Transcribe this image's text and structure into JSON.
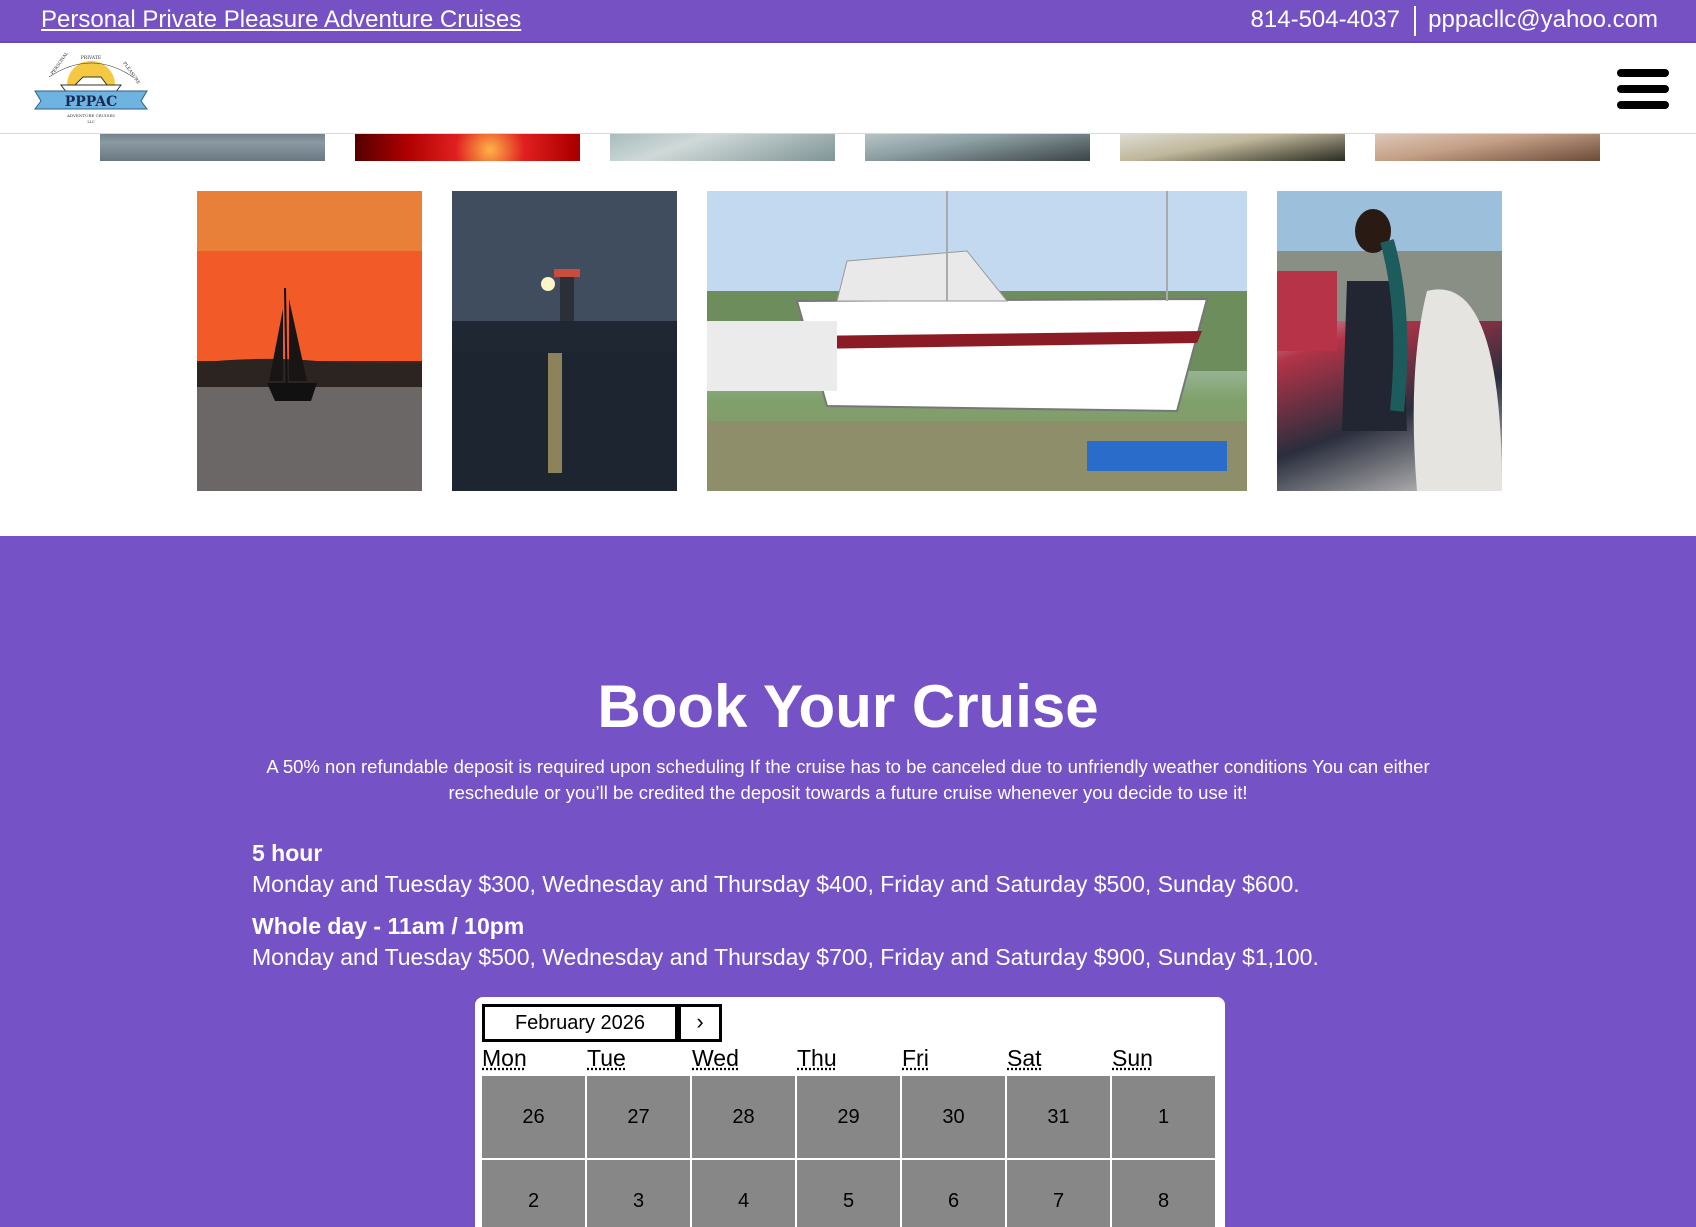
{
  "topbar": {
    "site_title": "Personal Private Pleasure Adventure Cruises",
    "phone": "814-504-4037",
    "email": "pppacllc@yahoo.com"
  },
  "header": {
    "logo_text": "PPPAC",
    "logo_arc_left": "PERSONAL",
    "logo_arc_mid": "PRIVATE",
    "logo_arc_right": "PLEASURE",
    "logo_sub": "ADVENTURE CRUISES",
    "logo_llc": "LLC",
    "menu_icon": "hamburger-menu-icon"
  },
  "booking": {
    "title": "Book Your Cruise",
    "description": "A 50% non refundable deposit is required upon scheduling If the cruise has to be canceled due to unfriendly weather conditions You can either reschedule or you’ll be credited the deposit towards a future cruise whenever you decide to use it!",
    "pricing": [
      {
        "heading": "5 hour",
        "text": "Monday and Tuesday $300, Wednesday and Thursday $400, Friday and Saturday $500, Sunday $600."
      },
      {
        "heading": "Whole day - 11am / 10pm",
        "text": "Monday and Tuesday $500, Wednesday and Thursday $700, Friday and Saturday $900, Sunday $1,100."
      }
    ]
  },
  "calendar": {
    "month": "February 2026",
    "next_label": "›",
    "weekdays": [
      "Mon",
      "Tue",
      "Wed",
      "Thu",
      "Fri",
      "Sat",
      "Sun"
    ],
    "weeks": [
      [
        "26",
        "27",
        "28",
        "29",
        "30",
        "31",
        "1"
      ],
      [
        "2",
        "3",
        "4",
        "5",
        "6",
        "7",
        "8"
      ]
    ]
  }
}
